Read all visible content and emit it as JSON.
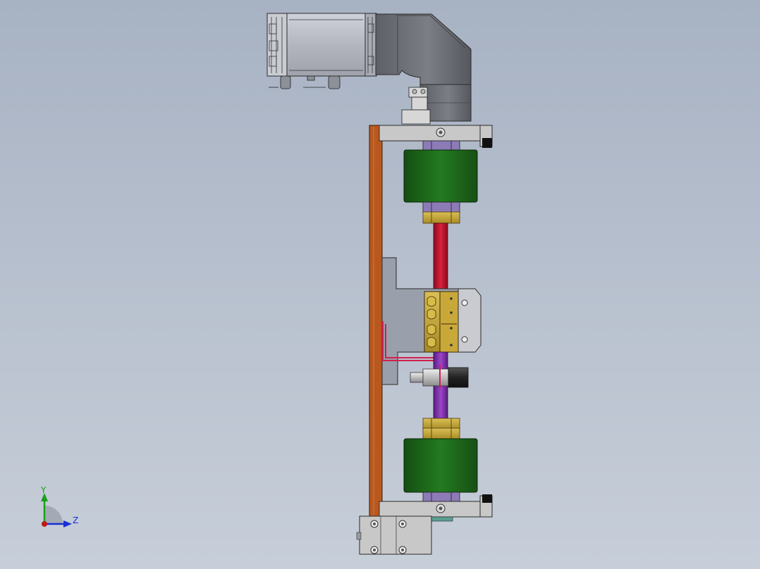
{
  "triad": {
    "y_label": "Y",
    "z_label": "Z",
    "colors": {
      "y": "#1aa01a",
      "z": "#1a2fd0",
      "x": "#c01818"
    }
  },
  "colors": {
    "background_top": "#a7b2c3",
    "background_bottom": "#c7ced9",
    "motor_body": "#b9bcc6",
    "gearbox": "#6e7178",
    "back_plate": "#b9581e",
    "bracket": "#c8c8c8",
    "coupling_green": "#1d6a1a",
    "shaft_red": "#c0102a",
    "shaft_purple": "#7a28a8",
    "nut_brass": "#c4a43a",
    "bearing_purple": "#8d7bb8",
    "carriage_plate": "#9aa0ab",
    "rail_red": "#d02050"
  },
  "icons": [
    "coordinate-triad-icon"
  ]
}
